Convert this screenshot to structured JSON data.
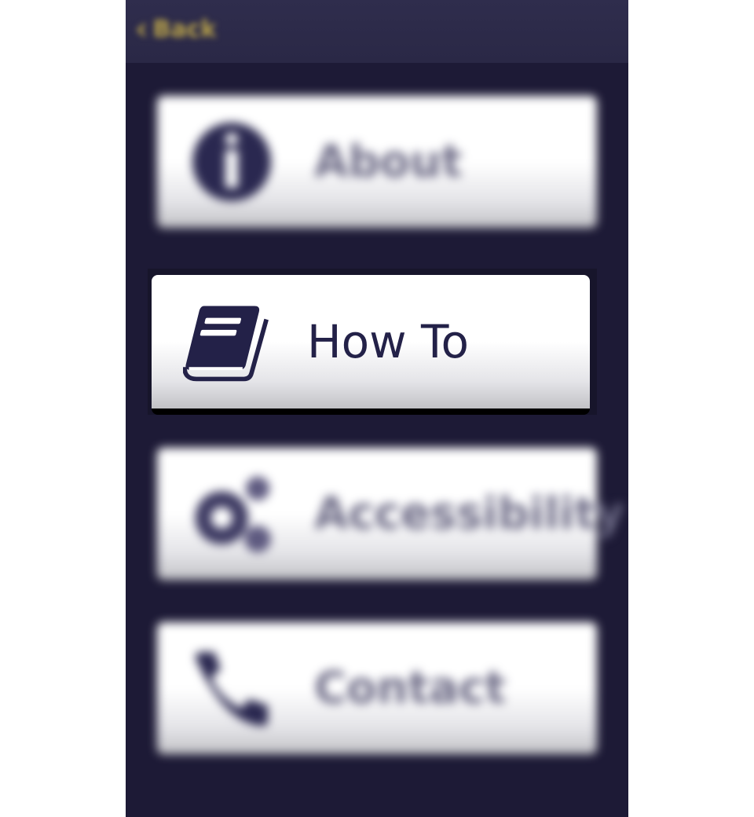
{
  "header": {
    "back_label": "Back"
  },
  "menu": {
    "items": [
      {
        "label": "About",
        "icon": "info-icon"
      },
      {
        "label": "How To",
        "icon": "book-icon"
      },
      {
        "label": "Accessibility",
        "icon": "gears-icon"
      },
      {
        "label": "Contact",
        "icon": "phone-icon"
      }
    ]
  },
  "colors": {
    "background": "#1d1a36",
    "header": "#2f2d4d",
    "accent_back": "#b8a24a",
    "icon": "#2a2850",
    "button": "#ffffff"
  }
}
